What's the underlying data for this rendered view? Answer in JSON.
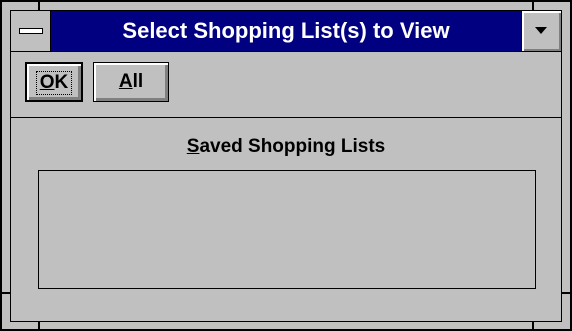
{
  "window": {
    "title": "Select Shopping List(s) to View"
  },
  "toolbar": {
    "ok_label_accel": "O",
    "ok_label_rest": "K",
    "all_label_accel": "A",
    "all_label_rest": "ll"
  },
  "saved_lists": {
    "label_accel": "S",
    "label_rest": "aved Shopping Lists",
    "items": []
  },
  "icons": {
    "system_menu": "system-menu-icon",
    "minimize": "down-arrow-icon"
  },
  "colors": {
    "titlebar": "#000080",
    "face": "#c0c0c0",
    "title_text": "#ffffff"
  }
}
